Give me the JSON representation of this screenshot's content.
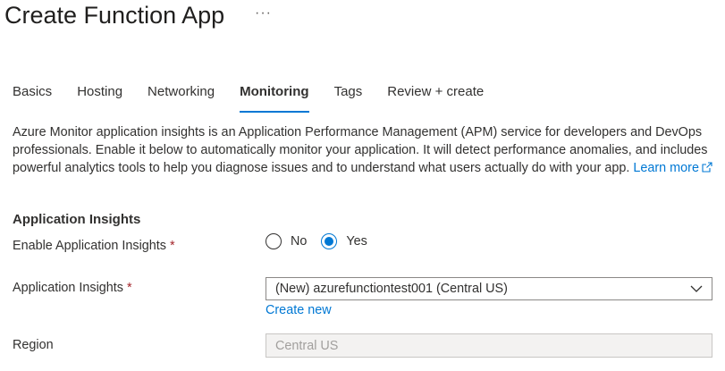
{
  "page": {
    "title": "Create Function App",
    "more_label": "···"
  },
  "tabs": [
    {
      "label": "Basics",
      "active": false
    },
    {
      "label": "Hosting",
      "active": false
    },
    {
      "label": "Networking",
      "active": false
    },
    {
      "label": "Monitoring",
      "active": true
    },
    {
      "label": "Tags",
      "active": false
    },
    {
      "label": "Review + create",
      "active": false
    }
  ],
  "description": {
    "text": "Azure Monitor application insights is an Application Performance Management (APM) service for developers and DevOps professionals. Enable it below to automatically monitor your application. It will detect performance anomalies, and includes powerful analytics tools to help you diagnose issues and to understand what users actually do with your app.",
    "learn_more": "Learn more",
    "learn_more_icon": "external-link-icon"
  },
  "section": {
    "title": "Application Insights"
  },
  "fields": {
    "enable": {
      "label": "Enable Application Insights",
      "required_mark": "*",
      "options": [
        "No",
        "Yes"
      ],
      "selected": "Yes"
    },
    "app_insights": {
      "label": "Application Insights",
      "required_mark": "*",
      "value": "(New) azurefunctiontest001 (Central US)",
      "create_new": "Create new",
      "icon": "chevron-down-icon"
    },
    "region": {
      "label": "Region",
      "value": "Central US"
    }
  },
  "colors": {
    "accent": "#0078d4",
    "required": "#a4262c",
    "text": "#323130"
  }
}
